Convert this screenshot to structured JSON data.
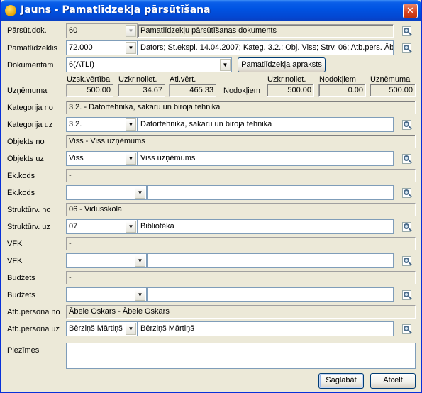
{
  "window": {
    "title": "Jauns - Pamatlīdzekļa pārsūtīšana",
    "close": "✕"
  },
  "labels": {
    "parsut_dok": "Pārsūt.dok.",
    "pamatlidzeklis": "Pamatlīdzeklis",
    "dokumentam": "Dokumentam",
    "uznemuma": "Uzņēmuma",
    "nodokliem": "Nodokļiem",
    "kategorija_no": "Kategorija no",
    "kategorija_uz": "Kategorija uz",
    "objekts_no": "Objekts no",
    "objekts_uz": "Objekts uz",
    "ek_kods_1": "Ek.kods",
    "ek_kods_2": "Ek.kods",
    "struktur_no": "Struktūrv. no",
    "struktur_uz": "Struktūrv. uz",
    "vfk_1": "VFK",
    "vfk_2": "VFK",
    "budzets_1": "Budžets",
    "budzets_2": "Budžets",
    "atb_no": "Atb.persona no",
    "atb_uz": "Atb.persona uz",
    "piezimes": "Piezīmes"
  },
  "fields": {
    "parsut_dok_code": "60",
    "parsut_dok_desc": "Pamatlīdzekļu pārsūtīšanas dokuments",
    "pamatl_code": "72.000",
    "pamatl_desc": "Dators; St.ekspl. 14.04.2007; Kateg. 3.2.; Obj. Viss; Strv. 06; Atb.pers. Ābel",
    "dokumentam_val": "6(ATLI)",
    "kategorija_no": "3.2. - Datortehnika, sakaru un biroja tehnika",
    "kategorija_uz_code": "3.2.",
    "kategorija_uz_desc": "Datortehnika, sakaru un biroja tehnika",
    "objekts_no": "Viss - Viss uzņēmums",
    "objekts_uz_code": "Viss",
    "objekts_uz_desc": "Viss uzņēmums",
    "ek_kods_no": "-",
    "ek_kods_uz_code": "",
    "ek_kods_uz_desc": "",
    "struktur_no": "06 - Vidusskola",
    "struktur_uz_code": "07",
    "struktur_uz_desc": "Bibliotēka",
    "vfk_no": "-",
    "vfk_uz_code": "",
    "vfk_uz_desc": "",
    "budzets_no": "-",
    "budzets_uz_code": "",
    "budzets_uz_desc": "",
    "atb_no": "Ābele Oskars - Ābele Oskars",
    "atb_uz_code": "Bērziņš Mārtiņš",
    "atb_uz_desc": "Bērziņš Mārtiņš",
    "piezimes": ""
  },
  "values": {
    "headers": {
      "uzsk_vertiba": "Uzsk.vērtība",
      "uzkr_noliet_1": "Uzkr.noliet.",
      "atl_vert": "Atl.vērt.",
      "uzkr_noliet_2": "Uzkr.noliet.",
      "nodokliem": "Nodokļiem",
      "uznemuma": "Uzņēmuma"
    },
    "uzsk_vertiba": "500.00",
    "uzkr_noliet_1": "34.67",
    "atl_vert": "465.33",
    "uzkr_noliet_2": "500.00",
    "nodokliem": "0.00",
    "uznemuma": "500.00"
  },
  "buttons": {
    "apraksts": "Pamatlīdzekļa apraksts",
    "saglabat": "Saglabāt",
    "atcelt": "Atcelt"
  },
  "dropdown_arrow": "▼"
}
